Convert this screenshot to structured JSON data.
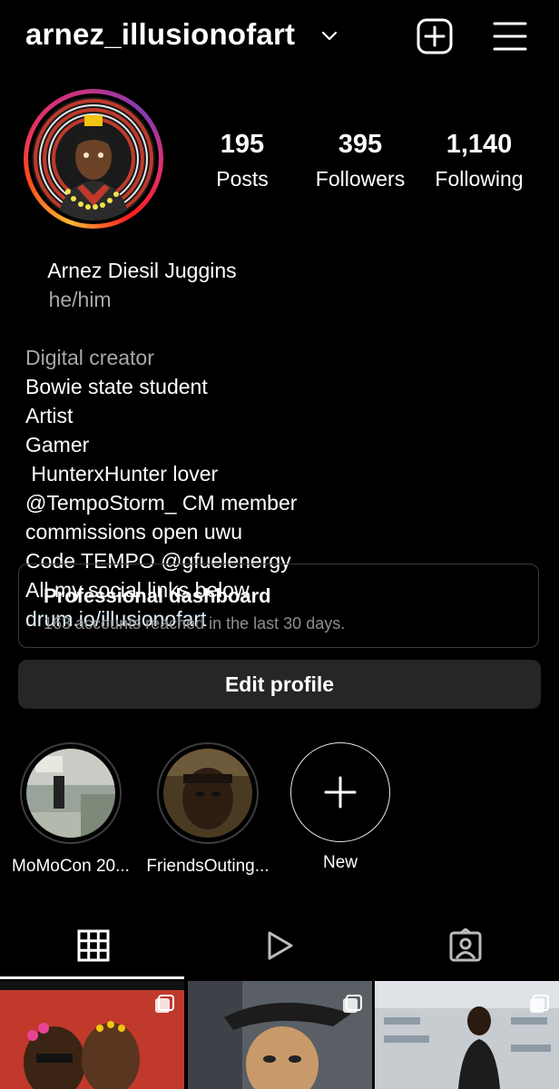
{
  "header": {
    "username": "arnez_illusionofart"
  },
  "stats": [
    {
      "value": "195",
      "label": "Posts"
    },
    {
      "value": "395",
      "label": "Followers"
    },
    {
      "value": "1,140",
      "label": "Following"
    }
  ],
  "bio": {
    "name": "Arnez Diesil Juggins",
    "pronouns": "he/him",
    "category": "Digital creator",
    "lines": [
      "Bowie state student",
      "Artist",
      "Gamer",
      " HunterxHunter lover",
      "@TempoStorm_ CM member",
      "commissions open uwu",
      "Code TEMPO @gfuelenergy",
      "All my social links below"
    ],
    "link": "drum.io/illusionofart"
  },
  "dashboard": {
    "title": "Professional dashboard",
    "subtitle": "163 accounts reached in the last 30 days."
  },
  "edit_profile_label": "Edit profile",
  "highlights": [
    {
      "label": "MoMoCon 20..."
    },
    {
      "label": "FriendsOuting..."
    },
    {
      "label": "New"
    }
  ],
  "tabs": [
    {
      "icon": "grid-icon",
      "active": true
    },
    {
      "icon": "reels-icon",
      "active": false
    },
    {
      "icon": "tagged-icon",
      "active": false
    }
  ],
  "colors": {
    "background": "#000000",
    "button_bg": "#262626",
    "muted_text": "#a8a8a8"
  }
}
